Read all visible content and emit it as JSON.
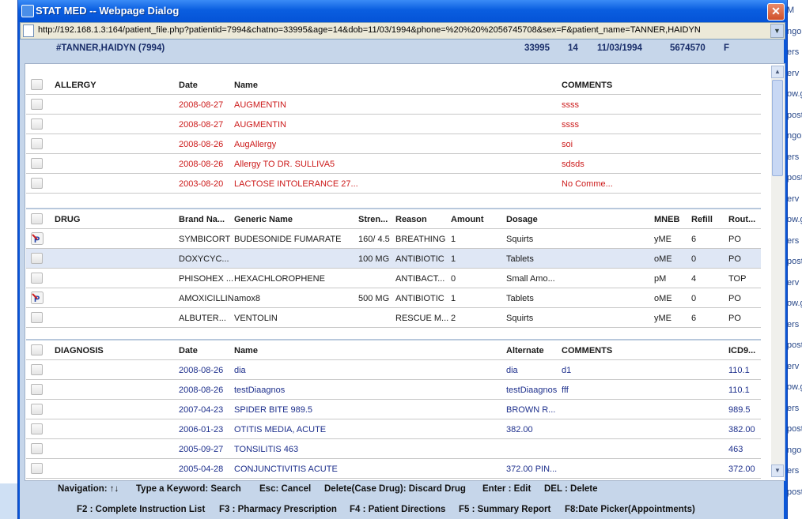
{
  "window": {
    "title": "STAT MED -- Webpage Dialog",
    "close_label": "✕",
    "url": "http://192.168.1.3:164/patient_file.php?patientid=7994&chatno=33995&age=14&dob=11/03/1994&phone=%20%20%2056745708&sex=F&patient_name=TANNER,HAIDYN"
  },
  "patient": {
    "name_id": "#TANNER,HAIDYN (7994)",
    "chart_no": "33995",
    "age": "14",
    "dob": "11/03/1994",
    "phone": "5674570",
    "sex": "F"
  },
  "allergy": {
    "headers": [
      "ALLERGY",
      "Date",
      "Name",
      "COMMENTS"
    ],
    "rows": [
      {
        "date": "2008-08-27",
        "name": "AUGMENTIN",
        "comments": "ssss"
      },
      {
        "date": "2008-08-27",
        "name": "AUGMENTIN",
        "comments": "ssss"
      },
      {
        "date": "2008-08-26",
        "name": "AugAllergy",
        "comments": "soi"
      },
      {
        "date": "2008-08-26",
        "name": "Allergy TO DR. SULLIVA5",
        "comments": "sdsds"
      },
      {
        "date": "2003-08-20",
        "name": "LACTOSE INTOLERANCE 27...",
        "comments": "No Comme..."
      }
    ]
  },
  "drug": {
    "headers": [
      "DRUG",
      "Brand Na...",
      "Generic Name",
      "Stren...",
      "Reason",
      "Amount",
      "Dosage",
      "MNEB",
      "Refill",
      "Rout..."
    ],
    "rows": [
      {
        "rx": true,
        "brand": "SYMBICORT",
        "generic": "BUDESONIDE FUMARATE",
        "strength": "160/ 4.5",
        "reason": "BREATHING",
        "amount": "1",
        "dosage": "Squirts",
        "mneb": "yME",
        "refill": "6",
        "route": "PO"
      },
      {
        "rx": false,
        "brand": "DOXYCYC...",
        "generic": "",
        "strength": "100 MG",
        "reason": "ANTIBIOTIC",
        "amount": "1",
        "dosage": "Tablets",
        "mneb": "oME",
        "refill": "0",
        "route": "PO"
      },
      {
        "rx": false,
        "brand": "PHISOHEX ...",
        "generic": "HEXACHLOROPHENE",
        "strength": "",
        "reason": "ANTIBACT...",
        "amount": "0",
        "dosage": "Small Amo...",
        "mneb": "pM",
        "refill": "4",
        "route": "TOP"
      },
      {
        "rx": true,
        "brand": "AMOXICILLIN",
        "generic": "amox8",
        "strength": "500 MG",
        "reason": "ANTIBIOTIC",
        "amount": "1",
        "dosage": "Tablets",
        "mneb": "oME",
        "refill": "0",
        "route": "PO"
      },
      {
        "rx": false,
        "brand": "ALBUTER...",
        "generic": "VENTOLIN",
        "strength": "",
        "reason": "RESCUE M...",
        "amount": "2",
        "dosage": "Squirts",
        "mneb": "yME",
        "refill": "6",
        "route": "PO"
      }
    ]
  },
  "diagnosis": {
    "headers": [
      "DIAGNOSIS",
      "Date",
      "Name",
      "Alternate",
      "COMMENTS",
      "ICD9..."
    ],
    "rows": [
      {
        "date": "2008-08-26",
        "name": "dia",
        "alternate": "dia",
        "comments": "d1",
        "icd9": "110.1"
      },
      {
        "date": "2008-08-26",
        "name": "testDiaagnos",
        "alternate": "testDiaagnos",
        "comments": "fff",
        "icd9": "110.1"
      },
      {
        "date": "2007-04-23",
        "name": "SPIDER BITE 989.5",
        "alternate": "BROWN R...",
        "comments": "",
        "icd9": "989.5"
      },
      {
        "date": "2006-01-23",
        "name": "OTITIS MEDIA, ACUTE",
        "alternate": "382.00",
        "comments": "",
        "icd9": "382.00"
      },
      {
        "date": "2005-09-27",
        "name": "TONSILITIS 463",
        "alternate": "",
        "comments": "",
        "icd9": "463"
      },
      {
        "date": "2005-04-28",
        "name": "CONJUNCTIVITIS ACUTE",
        "alternate": "372.00 PIN...",
        "comments": "",
        "icd9": "372.00"
      }
    ]
  },
  "footer": {
    "line1": [
      "Navigation: ↑↓",
      "Type a Keyword: Search",
      "Esc: Cancel",
      "Delete(Case Drug): Discard Drug",
      "Enter : Edit",
      "DEL : Delete"
    ],
    "line2": [
      "F2 : Complete Instruction List",
      "F3 : Pharmacy Prescription",
      "F4 : Patient Directions",
      "F5 : Summary Report",
      "F8:Date Picker(Appointments)"
    ]
  },
  "background_strip": [
    "M",
    "ngo",
    "ers",
    "erv",
    "ow.g",
    "post",
    "ngo",
    "ers",
    "post",
    "erv",
    "ow.g",
    "ers",
    "post",
    "erv",
    "ow.g",
    "ers",
    "post",
    "erv",
    "ow.g",
    "ers",
    "post",
    "ngo",
    "ers",
    "post"
  ],
  "colors": {
    "title_bar": "#0a5ee0",
    "allergy_text": "#cc1a1a",
    "diagnosis_text": "#1d2f8c",
    "panel_bg": "#c6d6ea"
  }
}
